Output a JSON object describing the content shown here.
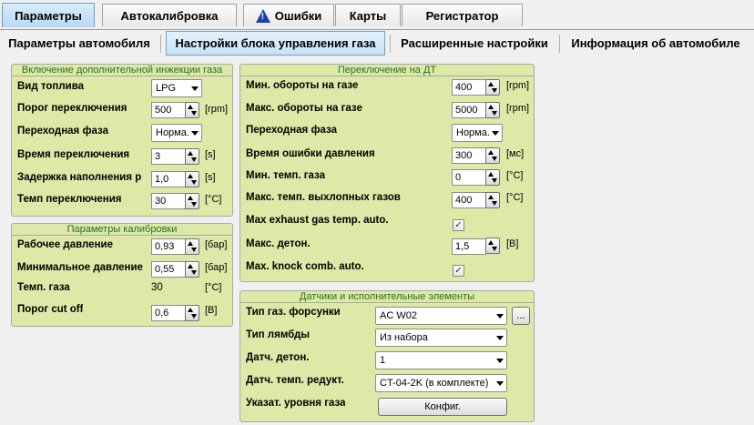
{
  "top_tabs": [
    {
      "label": "Параметры"
    },
    {
      "label": "Автокалибровка"
    },
    {
      "label": "Ошибки",
      "icon": "warning-icon"
    },
    {
      "label": "Карты"
    },
    {
      "label": "Регистратор"
    }
  ],
  "warning_mark": "!",
  "sub_tabs": [
    {
      "label": "Параметры автомобиля"
    },
    {
      "label": "Настройки блока управления газа"
    },
    {
      "label": "Расширенные настройки"
    },
    {
      "label": "Информация об автомобиле"
    }
  ],
  "injection": {
    "title": "Включение дополнительной инжекции газа",
    "fuel_type_label": "Вид топлива",
    "fuel_type_value": "LPG",
    "switch_threshold_label": "Порог переключения",
    "switch_threshold_value": "500",
    "switch_threshold_unit": "[rpm]",
    "transition_phase_label": "Переходная фаза",
    "transition_phase_value": "Норма.",
    "switch_time_label": "Время переключения",
    "switch_time_value": "3",
    "switch_time_unit": "[s]",
    "fill_delay_label": "Задержка наполнения р",
    "fill_delay_value": "1,0",
    "fill_delay_unit": "[s]",
    "switch_temp_label": "Темп переключения",
    "switch_temp_value": "30",
    "switch_temp_unit": "[°C]"
  },
  "calibration": {
    "title": "Параметры калибровки",
    "work_pressure_label": "Рабочее давление",
    "work_pressure_value": "0,93",
    "work_pressure_unit": "[бар]",
    "min_pressure_label": "Минимальное давление",
    "min_pressure_value": "0,55",
    "min_pressure_unit": "[бар]",
    "gas_temp_label": "Темп. газа",
    "gas_temp_value": "30",
    "gas_temp_unit": "[°C]",
    "cutoff_label": "Порог cut off",
    "cutoff_value": "0,6",
    "cutoff_unit": "[B]"
  },
  "dt_switch": {
    "title": "Переключение на ДТ",
    "min_rpm_label": "Мин. обороты на газе",
    "min_rpm_value": "400",
    "min_rpm_unit": "[rpm]",
    "max_rpm_label": "Макс. обороты на газе",
    "max_rpm_value": "5000",
    "max_rpm_unit": "[rpm]",
    "phase_label": "Переходная фаза",
    "phase_value": "Норма.",
    "pressure_error_label": "Время ошибки давления",
    "pressure_error_value": "300",
    "pressure_error_unit": "[мс]",
    "min_gas_temp_label": "Мин. темп. газа",
    "min_gas_temp_value": "0",
    "min_gas_temp_unit": "[°C]",
    "max_exhaust_label": "Макс. темп. выхлопных газов",
    "max_exhaust_value": "400",
    "max_exhaust_unit": "[°C]",
    "max_exhaust_auto_label": "Max exhaust gas temp. auto.",
    "max_exhaust_auto_checked": "✓",
    "max_knock_label": "Макс. детон.",
    "max_knock_value": "1,5",
    "max_knock_unit": "[B]",
    "knock_auto_label": "Max. knock comb. auto.",
    "knock_auto_checked": "✓"
  },
  "sensors": {
    "title": "Датчики и исполнительные элементы",
    "injector_type_label": "Тип газ. форсунки",
    "injector_type_value": "AC W02",
    "injector_browse_label": "...",
    "lambda_type_label": "Тип лямбды",
    "lambda_type_value": "Из набора",
    "knock_sensor_label": "Датч. детон.",
    "knock_sensor_value": "1",
    "reducer_temp_label": "Датч. темп. редукт.",
    "reducer_temp_value": "CT-04-2K (в комплекте)",
    "gas_level_label": "Указат. уровня газа",
    "config_button_label": "Конфиг."
  }
}
